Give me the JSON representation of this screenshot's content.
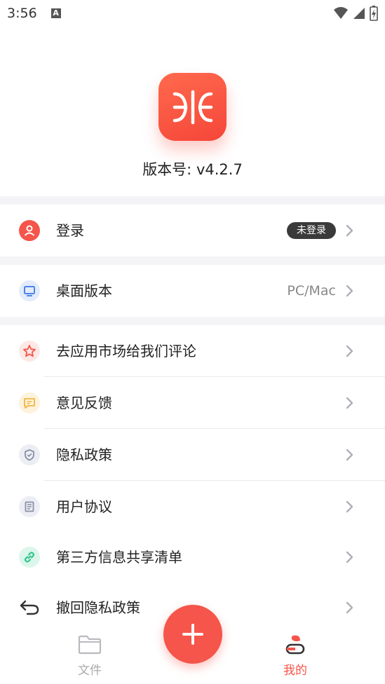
{
  "status_bar": {
    "time": "3:56",
    "notification_icon": "a-icon"
  },
  "app": {
    "version_label": "版本号: v4.2.7"
  },
  "rows": [
    {
      "id": "login",
      "label": "登录",
      "badge": "未登录",
      "icon": "user-icon",
      "color": "#f5554a"
    },
    {
      "id": "desktop",
      "label": "桌面版本",
      "value": "PC/Mac",
      "icon": "monitor-icon",
      "color": "#4b84e8"
    },
    {
      "id": "review",
      "label": "去应用市场给我们评论",
      "icon": "star-icon",
      "color": "#f5554a"
    },
    {
      "id": "feedback",
      "label": "意见反馈",
      "icon": "message-icon",
      "color": "#f2b544"
    },
    {
      "id": "privacy",
      "label": "隐私政策",
      "icon": "shield-icon",
      "color": "#8a8fa6"
    },
    {
      "id": "agreement",
      "label": "用户协议",
      "icon": "document-icon",
      "color": "#8a8fa6"
    },
    {
      "id": "third_party",
      "label": "第三方信息共享清单",
      "icon": "link-icon",
      "color": "#32c48d"
    },
    {
      "id": "revoke",
      "label": "撤回隐私政策",
      "icon": "undo-icon",
      "color": "#333333"
    }
  ],
  "nav": {
    "files_label": "文件",
    "mine_label": "我的",
    "active_color": "#f5554a",
    "inactive_color": "#aaaaaa"
  }
}
